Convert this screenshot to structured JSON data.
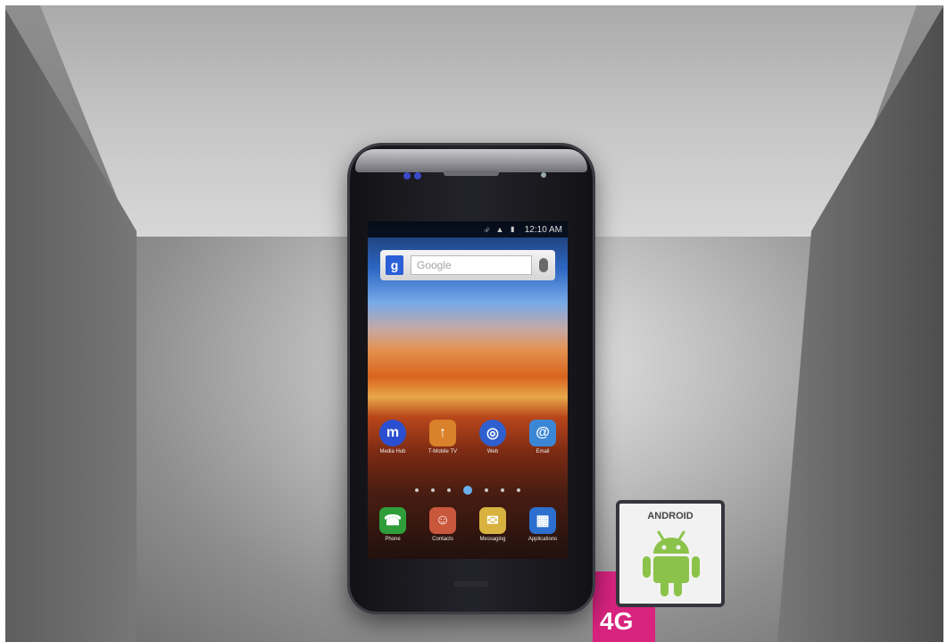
{
  "scene": {
    "description_colors": {
      "screen_accent": "#2d67c4",
      "brand_pink": "#d8237f",
      "android_green": "#8bc34a"
    }
  },
  "phone": {
    "status_time": "12:10 AM",
    "status_icons": "⮵ ▲ ▮",
    "search": {
      "logo": "g",
      "placeholder": "Google"
    },
    "apps_row1": [
      {
        "label": "Media Hub",
        "icon": "media-hub-icon",
        "glyph": "m",
        "color": "#2a4fd0"
      },
      {
        "label": "T-Mobile TV",
        "icon": "tmobile-tv-icon",
        "glyph": "↑",
        "color": "#d9822b"
      },
      {
        "label": "Web",
        "icon": "web-globe-icon",
        "glyph": "◎",
        "color": "#2f5fcf"
      },
      {
        "label": "Email",
        "icon": "email-icon",
        "glyph": "@",
        "color": "#3b87d6"
      }
    ],
    "apps_row2": [
      {
        "label": "Phone",
        "icon": "phone-icon",
        "glyph": "☎",
        "color": "#2f9e3a"
      },
      {
        "label": "Contacts",
        "icon": "contacts-icon",
        "glyph": "☺",
        "color": "#c9573b"
      },
      {
        "label": "Messaging",
        "icon": "messaging-icon",
        "glyph": "✉",
        "color": "#d8b23f"
      },
      {
        "label": "Applications",
        "icon": "applications-icon",
        "glyph": "▦",
        "color": "#2d6fcf"
      }
    ]
  },
  "badges": {
    "android": "ANDROID",
    "network": "4G"
  }
}
